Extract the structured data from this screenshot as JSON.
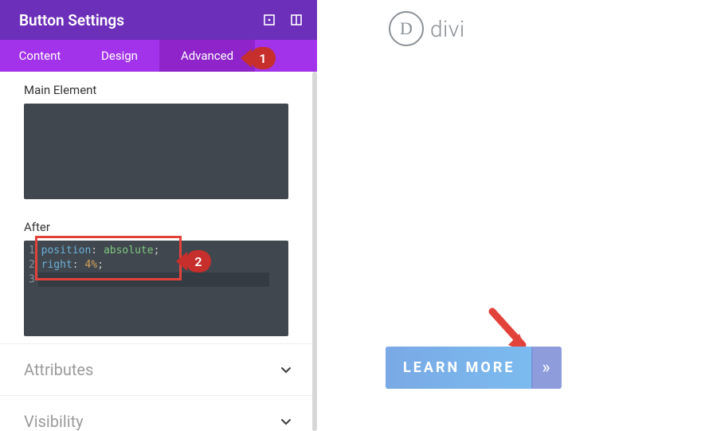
{
  "header": {
    "title": "Button Settings"
  },
  "tabs": {
    "content": "Content",
    "design": "Design",
    "advanced": "Advanced"
  },
  "fields": {
    "main_label": "Main Element",
    "after_label": "After"
  },
  "code_after": {
    "l1_prop": "position",
    "l1_val": "absolute",
    "l2_prop": "right",
    "l2_val": "4%"
  },
  "sections": {
    "attributes": "Attributes",
    "visibility": "Visibility"
  },
  "brand": {
    "text": "divi",
    "logo_letter": "D"
  },
  "button": {
    "label": "LEARN MORE",
    "chevron": "»"
  },
  "annotations": {
    "one": "1",
    "two": "2"
  }
}
